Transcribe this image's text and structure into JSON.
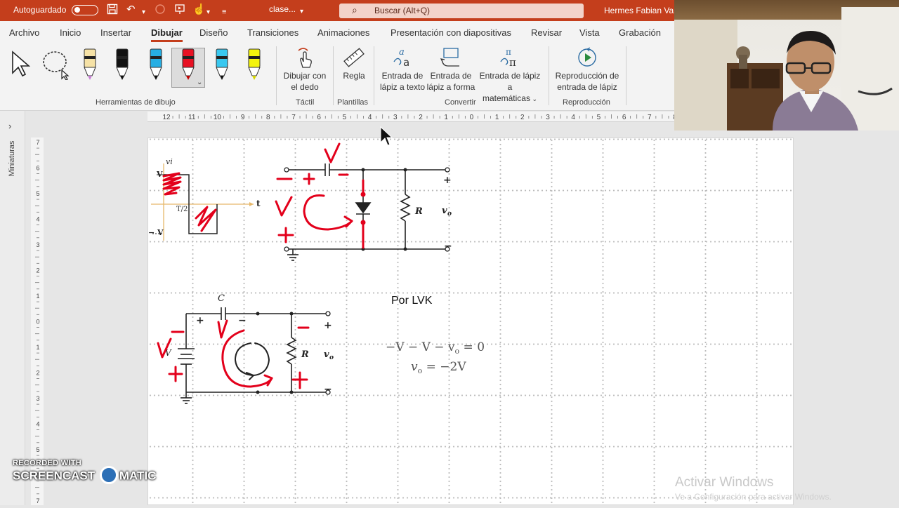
{
  "titlebar": {
    "autosave_label": "Autoguardado",
    "document_name": "clase...",
    "search_placeholder": "Buscar (Alt+Q)",
    "user_name": "Hermes Fabian Varc"
  },
  "tabs": [
    "Archivo",
    "Inicio",
    "Insertar",
    "Dibujar",
    "Diseño",
    "Transiciones",
    "Animaciones",
    "Presentación con diapositivas",
    "Revisar",
    "Vista",
    "Grabación"
  ],
  "active_tab": "Dibujar",
  "ribbon": {
    "draw_with_finger": [
      "Dibujar con",
      "el dedo"
    ],
    "ruler": "Regla",
    "ink_to_text": [
      "Entrada de",
      "lápiz a texto"
    ],
    "ink_to_shape": [
      "Entrada de",
      "lápiz a forma"
    ],
    "ink_to_math": [
      "Entrada de lápiz a",
      "matemáticas"
    ],
    "ink_replay": [
      "Reproducción de",
      "entrada de lápiz"
    ],
    "groups": [
      "Herramientas de dibujo",
      "Táctil",
      "Plantillas",
      "Convertir",
      "Reproducción"
    ],
    "pens": [
      {
        "name": "pencil-pen",
        "color": "#f6e2a6",
        "tip": "#c77fd3"
      },
      {
        "name": "black-pen",
        "color": "#111111",
        "tip": "#111111"
      },
      {
        "name": "cyan-pen",
        "color": "#26aee3",
        "tip": "#111111"
      },
      {
        "name": "red-pen",
        "color": "#e81123",
        "tip": "#c00000"
      },
      {
        "name": "cyan-pencil",
        "color": "#39c8f0",
        "tip": "#111111"
      },
      {
        "name": "yellow-highlighter",
        "color": "#f4f40c",
        "tip": "#d4d400"
      }
    ]
  },
  "sidebar": {
    "label": "Miniaturas"
  },
  "rulers": {
    "horizontal": [
      "12",
      "11",
      "10",
      "9",
      "8",
      "7",
      "6",
      "5",
      "4",
      "3",
      "2",
      "1",
      "0",
      "1",
      "2",
      "3",
      "4",
      "5",
      "6",
      "7",
      "8"
    ],
    "vertical": [
      "7",
      "6",
      "5",
      "4",
      "3",
      "2",
      "1",
      "0",
      "1",
      "2",
      "3",
      "4",
      "5",
      "6",
      "7"
    ]
  },
  "slide": {
    "circuit1": {
      "labels": {
        "vi_wave": "vi",
        "v_plus": "V",
        "v_minus": "− V",
        "t_axis": "t",
        "t_half": "T/2",
        "r": "R",
        "vo": "v",
        "vo_sub": "o",
        "plus": "+",
        "minus": "−"
      }
    },
    "circuit2": {
      "labels": {
        "c": "C",
        "v": "V",
        "r": "R",
        "vo": "v",
        "vo_sub": "o",
        "plus": "+",
        "minus": "−"
      }
    },
    "lvk_title": "Por LVK",
    "eq1": "−V − V − v",
    "eq1_end": " = 0",
    "eq2": "v",
    "eq2_end": " = −2V",
    "sub_o": "o"
  },
  "watermark": {
    "line1": "Activar Windows",
    "line2": "Ve a Configuración para activar Windows."
  },
  "screencast": {
    "line1": "RECORDED WITH",
    "line2": "SCREENCAST",
    "line3": "MATIC"
  },
  "colors": {
    "accent": "#c43e1c",
    "ink_red": "#e3001b"
  }
}
